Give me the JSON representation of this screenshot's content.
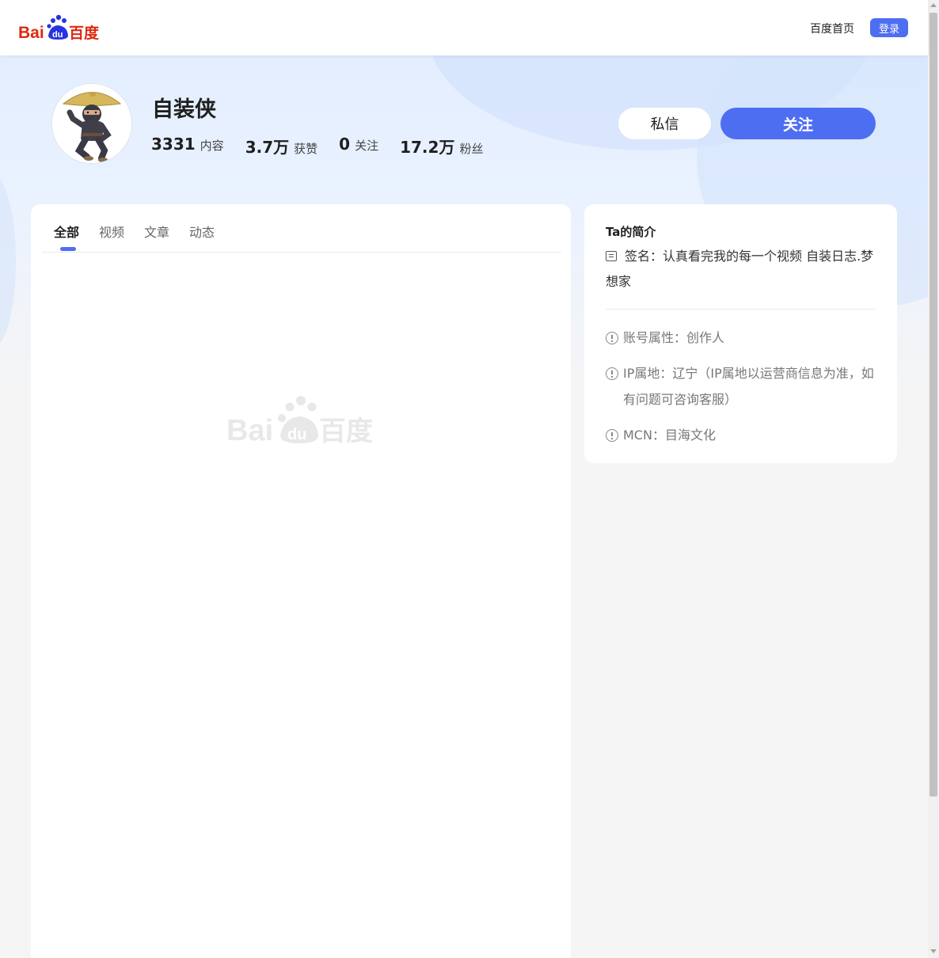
{
  "header": {
    "logo_text": "Bai百度",
    "logo_mark": "du",
    "home_link": "百度首页",
    "login_label": "登录"
  },
  "profile": {
    "name": "自装侠",
    "stats": [
      {
        "value": "3331",
        "label": "内容"
      },
      {
        "value": "3.7万",
        "label": "获赞"
      },
      {
        "value": "0",
        "label": "关注"
      },
      {
        "value": "17.2万",
        "label": "粉丝"
      }
    ],
    "message_label": "私信",
    "follow_label": "关注"
  },
  "tabs": [
    {
      "label": "全部",
      "active": true
    },
    {
      "label": "视频",
      "active": false
    },
    {
      "label": "文章",
      "active": false
    },
    {
      "label": "动态",
      "active": false
    }
  ],
  "intro": {
    "title": "Ta的简介",
    "signature": "签名：认真看完我的每一个视频 自装日志.梦想家",
    "items": [
      "账号属性：创作人",
      "IP属地：辽宁（IP属地以运营商信息为准，如有问题可咨询客服）",
      "MCN：目海文化"
    ]
  },
  "colors": {
    "accent": "#4e6ef2",
    "logo_red": "#de2910",
    "logo_blue": "#2932e1"
  },
  "icons": {
    "signature": "note-icon",
    "info": "info-circle-icon"
  }
}
